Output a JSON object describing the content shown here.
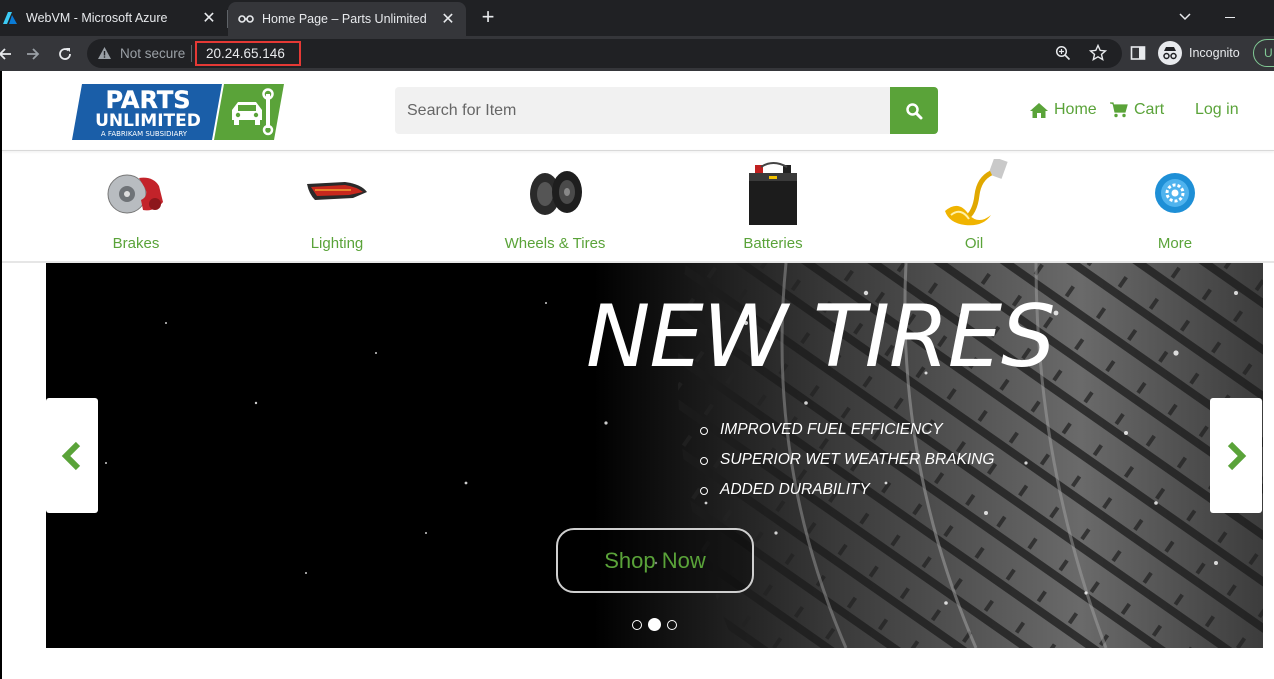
{
  "browser": {
    "tabs": [
      {
        "title": "WebVM - Microsoft Azure",
        "icon": "azure-icon",
        "active": false
      },
      {
        "title": "Home Page – Parts Unlimited",
        "icon": "incognito-tab-icon",
        "active": true
      }
    ],
    "security_label": "Not secure",
    "url": "20.24.65.146",
    "profile_label": "Incognito",
    "update_label": "U"
  },
  "header": {
    "logo": {
      "line1": "PARTS",
      "line2": "UNLIMITED",
      "tagline": "A FABRIKAM SUBSIDIARY"
    },
    "search_placeholder": "Search for Item",
    "nav": {
      "home": "Home",
      "cart": "Cart",
      "login": "Log in"
    }
  },
  "categories": [
    {
      "label": "Brakes",
      "icon": "brake-disc-icon"
    },
    {
      "label": "Lighting",
      "icon": "tail-light-icon"
    },
    {
      "label": "Wheels & Tires",
      "icon": "tires-icon"
    },
    {
      "label": "Batteries",
      "icon": "battery-icon"
    },
    {
      "label": "Oil",
      "icon": "oil-pour-icon"
    },
    {
      "label": "More",
      "icon": "more-gear-icon"
    }
  ],
  "carousel": {
    "title": "NEW TIRES",
    "features": [
      "IMPROVED FUEL EFFICIENCY",
      "SUPERIOR WET WEATHER BRAKING",
      "ADDED DURABILITY"
    ],
    "button": "Shop Now",
    "slide_count": 3,
    "active_slide": 2
  },
  "colors": {
    "brand_green": "#5aa339",
    "brand_blue": "#1a5ea8",
    "url_highlight": "#e53935"
  }
}
